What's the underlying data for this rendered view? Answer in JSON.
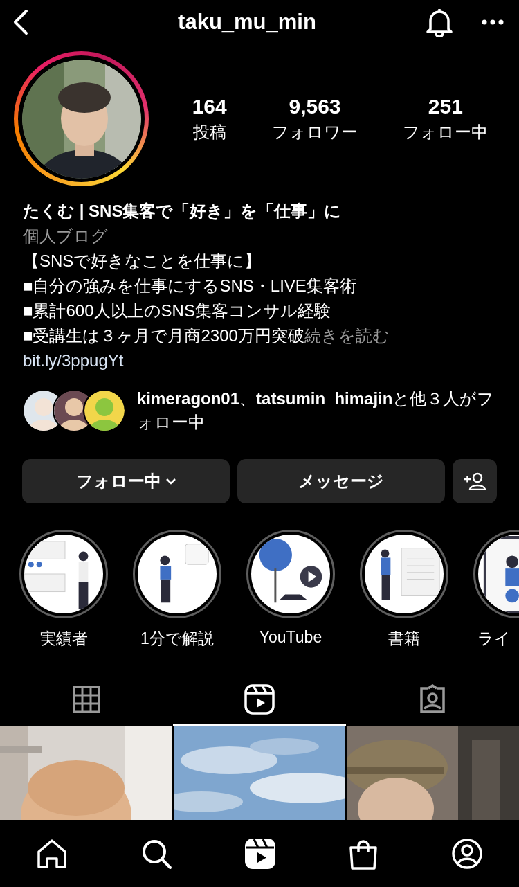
{
  "header": {
    "title": "taku_mu_min"
  },
  "stats": [
    {
      "value": "164",
      "label": "投稿"
    },
    {
      "value": "9,563",
      "label": "フォロワー"
    },
    {
      "value": "251",
      "label": "フォロー中"
    }
  ],
  "bio": {
    "name": "たくむ | SNS集客で「好き」を「仕事」に",
    "category": "個人ブログ",
    "lines": [
      "【SNSで好きなことを仕事に】",
      "■自分の強みを仕事にするSNS・LIVE集客術",
      "■累計600人以上のSNS集客コンサル経験",
      "■受講生は３ヶ月で月商2300万円突破"
    ],
    "more": "続きを読む",
    "link": "bit.ly/3ppugYt"
  },
  "followed_by": {
    "text": "**kimeragon01**、**tatsumin_himajin**と他３人がフォロー中"
  },
  "buttons": [
    {
      "kind": "dropdown",
      "label": "フォロー中"
    },
    {
      "kind": "plain",
      "label": "メッセージ"
    },
    {
      "kind": "add-person"
    }
  ],
  "highlights": [
    {
      "label": "実績者"
    },
    {
      "label": "1分で解説"
    },
    {
      "label": "YouTube"
    },
    {
      "label": "書籍"
    },
    {
      "label": "ライ"
    }
  ],
  "tabs": [
    {
      "kind": "grid",
      "selected": false
    },
    {
      "kind": "reels",
      "selected": true
    },
    {
      "kind": "tagged",
      "selected": false
    }
  ],
  "nav": [
    {
      "kind": "home"
    },
    {
      "kind": "search"
    },
    {
      "kind": "reels"
    },
    {
      "kind": "shop"
    },
    {
      "kind": "profile"
    }
  ]
}
